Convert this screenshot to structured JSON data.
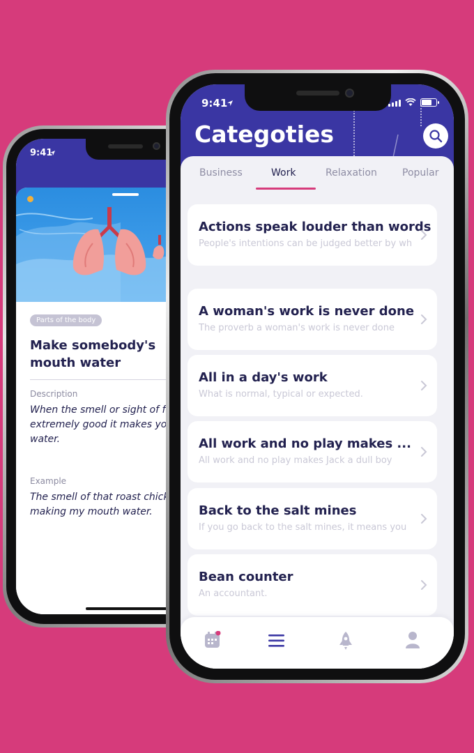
{
  "back_phone": {
    "time": "9:41",
    "badge": "Parts of the body",
    "title": "Make somebody's mouth water",
    "description_label": "Description",
    "description_text": "When the smell or sight of fo\nextremely good it makes you\nwater.",
    "example_label": "Example",
    "example_text": "The smell of that roast chick\nmaking my mouth water."
  },
  "front_phone": {
    "time": "9:41",
    "title": "Categoties",
    "tabs": [
      "Business",
      "Work",
      "Relaxation",
      "Popular"
    ],
    "active_tab": "Work",
    "cards": [
      {
        "title": "Actions speak louder than words",
        "subtitle": "People's intentions can be judged better by wh"
      },
      {
        "title": "A woman's work is never done",
        "subtitle": "The proverb a woman's work is never done"
      },
      {
        "title": "All in a day's work",
        "subtitle": "What is normal, typical or expected."
      },
      {
        "title": "All work and no play makes ...",
        "subtitle": "All work and no play makes Jack a dull boy"
      },
      {
        "title": "Back to the salt mines",
        "subtitle": "If you go back to the salt mines, it means you"
      },
      {
        "title": "Bean counter",
        "subtitle": "An accountant."
      }
    ],
    "tabbar": [
      "calendar-icon",
      "menu-icon",
      "rocket-icon",
      "profile-icon"
    ]
  },
  "colors": {
    "background": "#d63b7b",
    "header": "#3a36a3",
    "accent": "#d63b7b",
    "title_text": "#22214f",
    "muted_text": "#c9c8d6"
  }
}
